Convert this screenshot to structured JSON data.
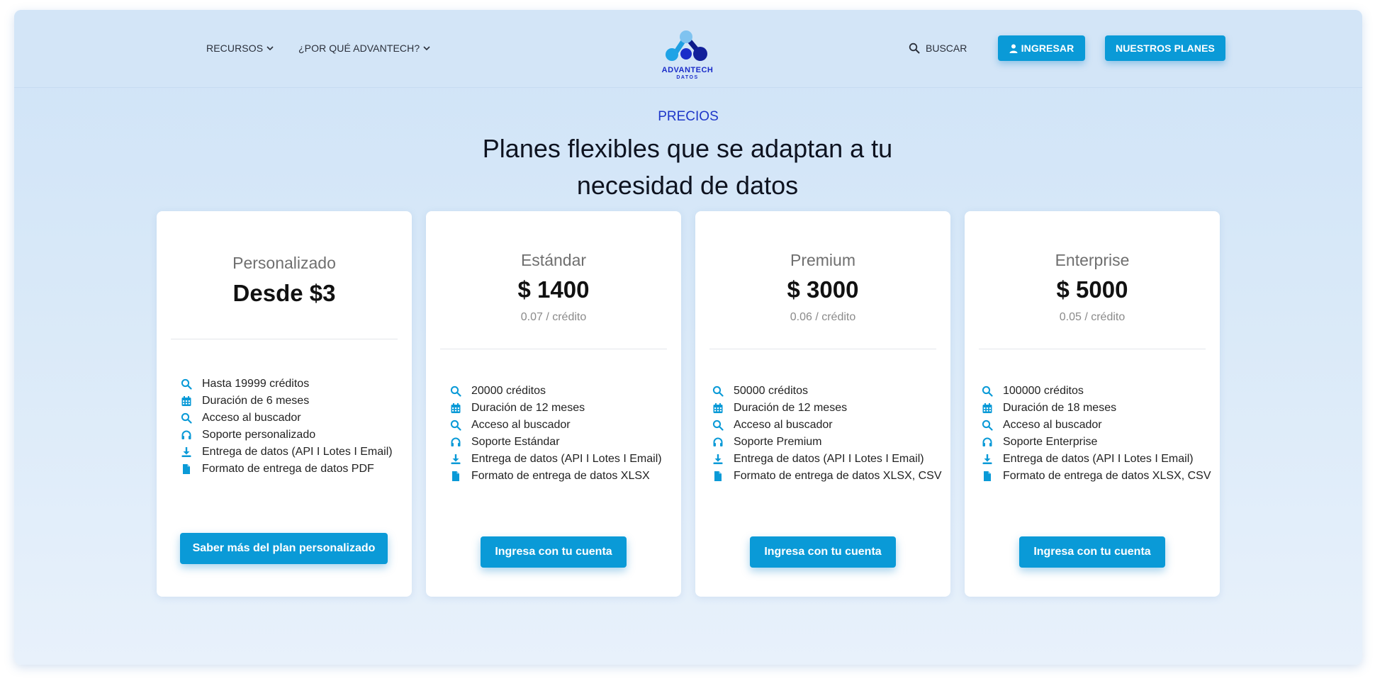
{
  "nav": {
    "recursos": "RECURSOS",
    "por_que": "¿POR QUÉ ADVANTECH?",
    "buscar": "BUSCAR",
    "ingresar": "INGRESAR",
    "nuestros_planes": "NUESTROS PLANES"
  },
  "logo": {
    "name": "ADVANTECH",
    "sub": "DATOS"
  },
  "hero": {
    "eyebrow": "PRECIOS",
    "headline": "Planes flexibles que se adaptan a tu necesidad de datos"
  },
  "colors": {
    "accent": "#0a9ad7",
    "brand": "#1d36c9"
  },
  "plans": [
    {
      "name": "Personalizado",
      "price": "Desde $3",
      "unit": "",
      "features": [
        {
          "icon": "search-icon",
          "text": "Hasta 19999 créditos"
        },
        {
          "icon": "calendar-icon",
          "text": "Duración de 6 meses"
        },
        {
          "icon": "search-icon",
          "text": "Acceso al buscador"
        },
        {
          "icon": "headset-icon",
          "text": "Soporte personalizado"
        },
        {
          "icon": "download-icon",
          "text": "Entrega de datos (API I Lotes I Email)"
        },
        {
          "icon": "file-icon",
          "text": "Formato de entrega de datos PDF"
        }
      ],
      "cta": "Saber más del plan personalizado"
    },
    {
      "name": "Estándar",
      "price": "$ 1400",
      "unit": "0.07 / crédito",
      "features": [
        {
          "icon": "search-icon",
          "text": "20000 créditos"
        },
        {
          "icon": "calendar-icon",
          "text": "Duración de 12 meses"
        },
        {
          "icon": "search-icon",
          "text": "Acceso al buscador"
        },
        {
          "icon": "headset-icon",
          "text": "Soporte Estándar"
        },
        {
          "icon": "download-icon",
          "text": "Entrega de datos (API I Lotes I Email)"
        },
        {
          "icon": "file-icon",
          "text": "Formato de entrega de datos XLSX"
        }
      ],
      "cta": "Ingresa con tu cuenta"
    },
    {
      "name": "Premium",
      "price": "$ 3000",
      "unit": "0.06 / crédito",
      "features": [
        {
          "icon": "search-icon",
          "text": "50000 créditos"
        },
        {
          "icon": "calendar-icon",
          "text": "Duración de 12 meses"
        },
        {
          "icon": "search-icon",
          "text": "Acceso al buscador"
        },
        {
          "icon": "headset-icon",
          "text": "Soporte Premium"
        },
        {
          "icon": "download-icon",
          "text": "Entrega de datos (API I Lotes I Email)"
        },
        {
          "icon": "file-icon",
          "text": "Formato de entrega de datos XLSX, CSV"
        }
      ],
      "cta": "Ingresa con tu cuenta"
    },
    {
      "name": "Enterprise",
      "price": "$ 5000",
      "unit": "0.05 / crédito",
      "features": [
        {
          "icon": "search-icon",
          "text": "100000 créditos"
        },
        {
          "icon": "calendar-icon",
          "text": "Duración de 18 meses"
        },
        {
          "icon": "search-icon",
          "text": "Acceso al buscador"
        },
        {
          "icon": "headset-icon",
          "text": "Soporte Enterprise"
        },
        {
          "icon": "download-icon",
          "text": "Entrega de datos (API I Lotes I Email)"
        },
        {
          "icon": "file-icon",
          "text": "Formato de entrega de datos XLSX, CSV"
        }
      ],
      "cta": "Ingresa con tu cuenta"
    }
  ]
}
